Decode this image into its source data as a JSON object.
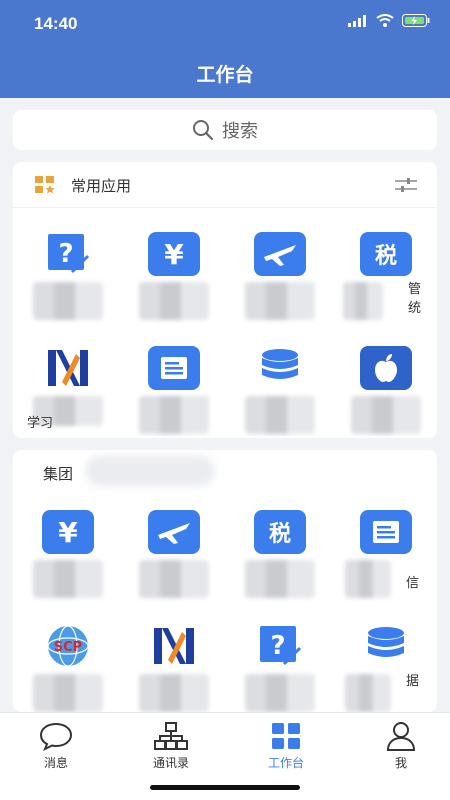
{
  "status_bar": {
    "time": "14:40"
  },
  "header": {
    "title": "工作台"
  },
  "search": {
    "label": "搜索"
  },
  "common_apps": {
    "title": "常用应用",
    "apps": [
      {
        "label": "",
        "icon": "help-doc-icon"
      },
      {
        "label": "",
        "icon": "yuan-icon"
      },
      {
        "label": "",
        "icon": "plane-icon"
      },
      {
        "label": "管\n统",
        "icon": "tax-icon"
      },
      {
        "label": "学习",
        "icon": "learning-logo-icon"
      },
      {
        "label": "",
        "icon": "notice-icon"
      },
      {
        "label": "",
        "icon": "database-icon"
      },
      {
        "label": "",
        "icon": "apple-icon"
      }
    ]
  },
  "group_apps": {
    "title": "集团",
    "apps": [
      {
        "label": "",
        "icon": "yuan-icon"
      },
      {
        "label": "",
        "icon": "plane-icon"
      },
      {
        "label": "",
        "icon": "tax-icon"
      },
      {
        "label": "信",
        "icon": "notice-icon"
      },
      {
        "label": "",
        "icon": "scp-globe-icon"
      },
      {
        "label": "",
        "icon": "learning-logo-icon"
      },
      {
        "label": "",
        "icon": "help-doc-icon"
      },
      {
        "label": "据",
        "icon": "database-icon"
      }
    ]
  },
  "tabbar": {
    "items": [
      {
        "label": "消息",
        "icon": "chat-bubble-icon"
      },
      {
        "label": "通讯录",
        "icon": "org-chart-icon"
      },
      {
        "label": "工作台",
        "icon": "grid-icon",
        "active": true
      },
      {
        "label": "我",
        "icon": "person-icon"
      }
    ]
  },
  "colors": {
    "header": "#4a78cf",
    "icon_blue": "#3b7ded",
    "active_tab": "#3b7ded"
  }
}
